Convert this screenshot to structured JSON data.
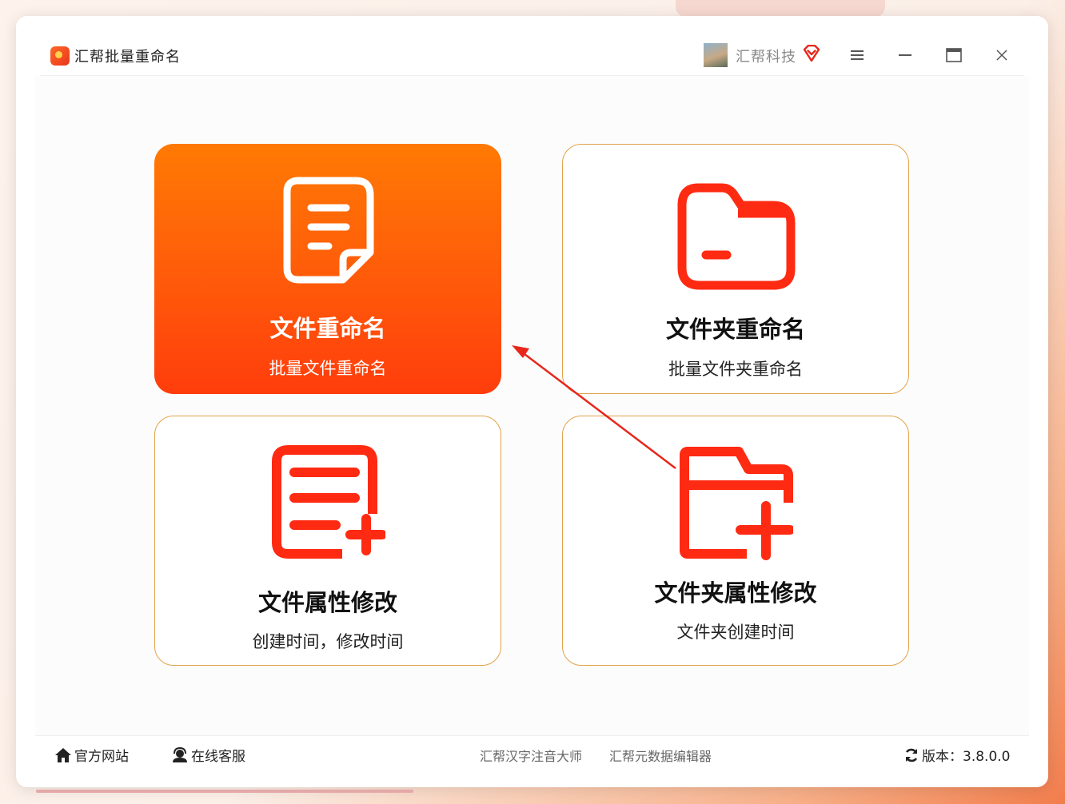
{
  "window": {
    "title": "汇帮批量重命名",
    "brand": "汇帮科技"
  },
  "cards": [
    {
      "title": "文件重命名",
      "subtitle": "批量文件重命名",
      "icon": "document-icon",
      "active": true
    },
    {
      "title": "文件夹重命名",
      "subtitle": "批量文件夹重命名",
      "icon": "folder-icon",
      "active": false
    },
    {
      "title": "文件属性修改",
      "subtitle": "创建时间，修改时间",
      "icon": "document-plus-icon",
      "active": false
    },
    {
      "title": "文件夹属性修改",
      "subtitle": "文件夹创建时间",
      "icon": "folder-plus-icon",
      "active": false
    }
  ],
  "footer": {
    "website": "官方网站",
    "support": "在线客服",
    "link1": "汇帮汉字注音大师",
    "link2": "汇帮元数据编辑器",
    "version": "版本：3.8.0.0"
  },
  "colors": {
    "accent": "#ff3d0c",
    "accent_light": "#ff7a04",
    "card_border": "#e2a24a",
    "icon_red": "#ff2a12"
  }
}
